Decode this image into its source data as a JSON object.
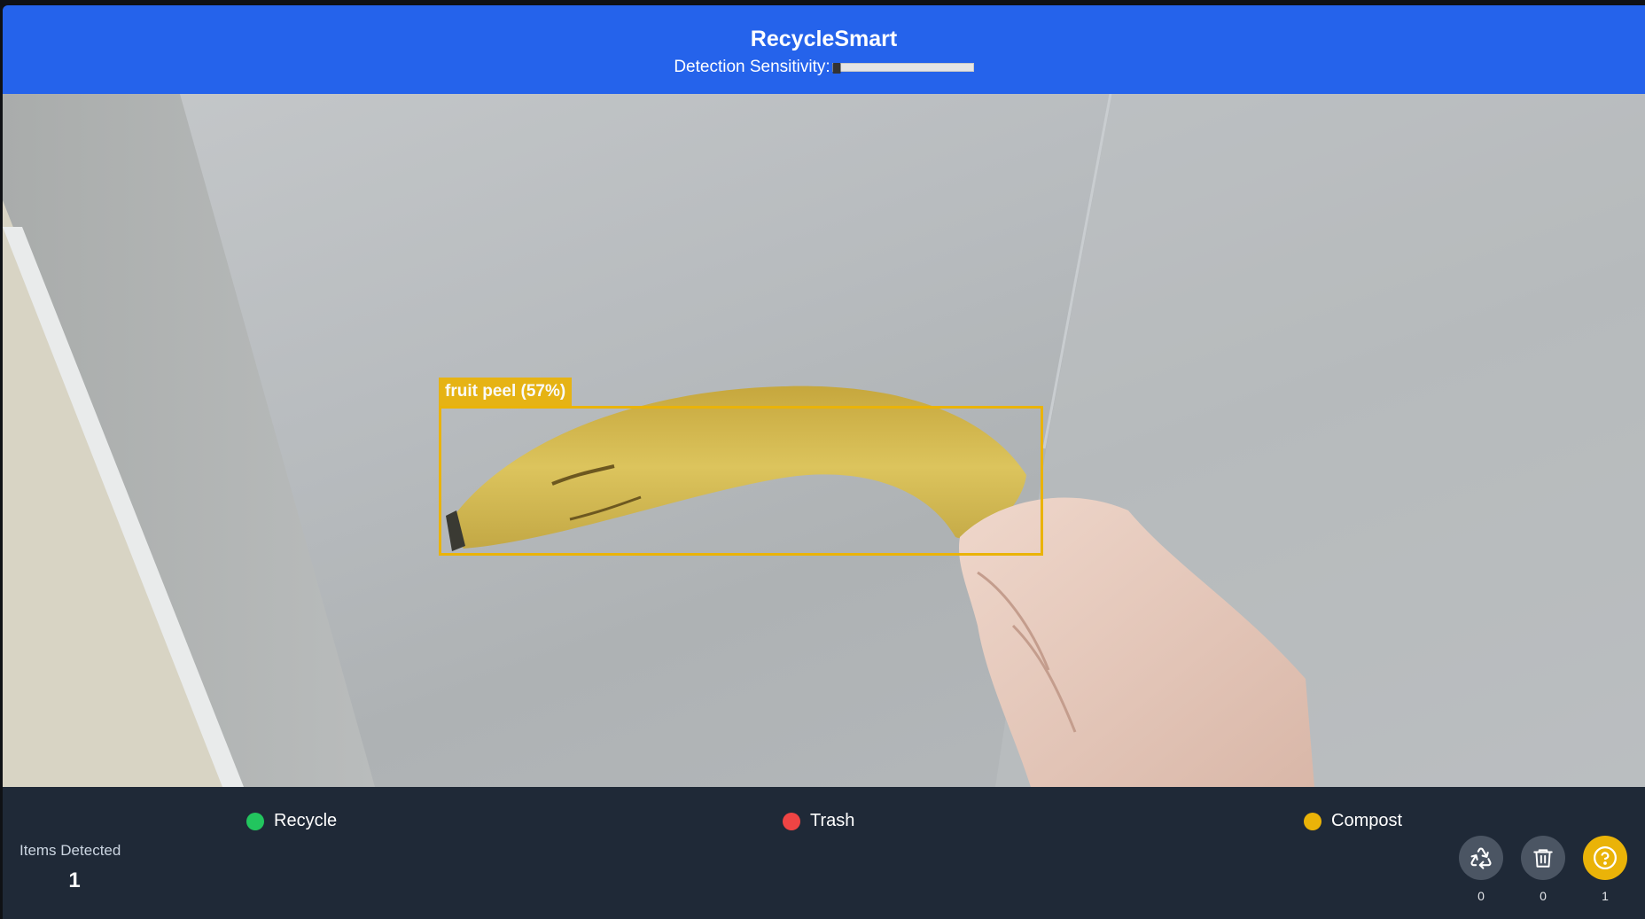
{
  "app": {
    "title": "RecycleSmart",
    "sensitivity_label": "Detection Sensitivity:",
    "sensitivity_value": 0.03
  },
  "detection": {
    "label": "fruit peel (57%)",
    "color": "#eab308"
  },
  "legend": [
    {
      "label": "Recycle",
      "color": "#22c55e"
    },
    {
      "label": "Trash",
      "color": "#ef4444"
    },
    {
      "label": "Compost",
      "color": "#eab308"
    }
  ],
  "stats": {
    "items_label": "Items Detected",
    "items_count": "1"
  },
  "bins": [
    {
      "icon": "recycle-icon",
      "count": "0",
      "active": false
    },
    {
      "icon": "trash-icon",
      "count": "0",
      "active": false
    },
    {
      "icon": "help-icon",
      "count": "1",
      "active": true
    }
  ],
  "colors": {
    "header": "#2563eb",
    "footer": "#1f2937",
    "bin_inactive": "#4b5563"
  }
}
